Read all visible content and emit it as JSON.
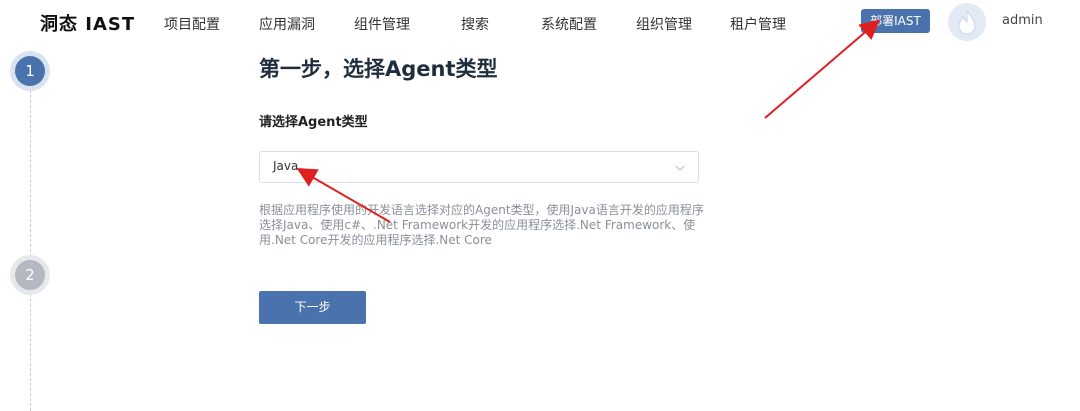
{
  "brand": {
    "logo_text": "洞态 IAST"
  },
  "nav": {
    "items": [
      "项目配置",
      "应用漏洞",
      "组件管理",
      "搜索",
      "系统配置",
      "组织管理",
      "租户管理"
    ],
    "deploy_label": "部署IAST",
    "username": "admin"
  },
  "steps": [
    "1",
    "2"
  ],
  "main": {
    "title": "第一步，选择Agent类型",
    "field_label": "请选择Agent类型",
    "select_value": "Java",
    "hint": "根据应用程序使用的开发语言选择对应的Agent类型，使用Java语言开发的应用程序选择Java、使用c#、.Net Framework开发的应用程序选择.Net Framework、使用.Net Core开发的应用程序选择.Net Core",
    "next_label": "下一步"
  },
  "icons": {
    "avatar": "flame-avatar-icon",
    "select_arrow": "chevron-down-icon"
  },
  "colors": {
    "accent": "#4a73ad",
    "annotation_arrow": "#e02020"
  }
}
